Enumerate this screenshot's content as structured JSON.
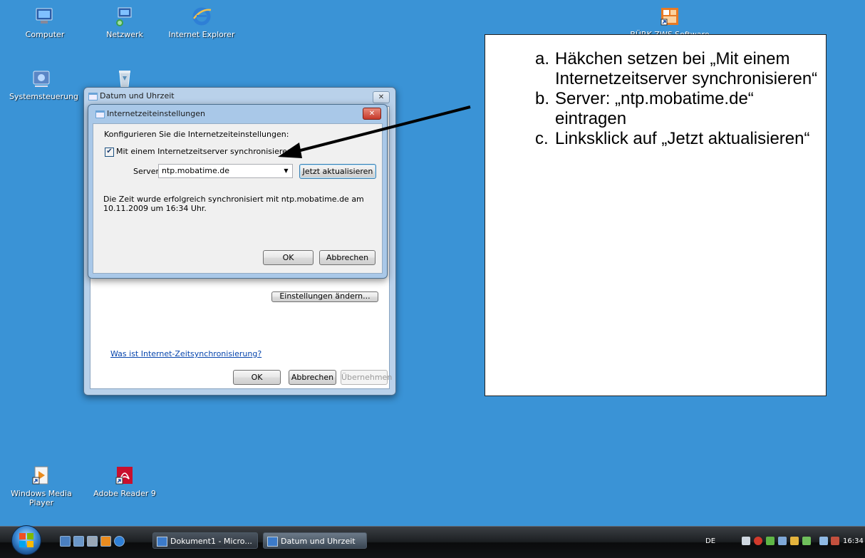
{
  "desktop": {
    "icons": [
      {
        "label": "Computer"
      },
      {
        "label": "Netzwerk"
      },
      {
        "label": "Internet Explorer"
      },
      {
        "label": "BÜRK ZWS Software"
      },
      {
        "label": "Systemsteuerung"
      },
      {
        "label": "Windows Media Player"
      },
      {
        "label": "Adobe Reader 9"
      }
    ]
  },
  "back_window": {
    "title": "Datum und Uhrzeit",
    "hidden_button_label": "Einstellungen ändern...",
    "help_link": "Was ist Internet-Zeitsynchronisierung?",
    "ok_label": "OK",
    "cancel_label": "Abbrechen",
    "apply_label": "Übernehmen"
  },
  "front_window": {
    "title": "Internetzeiteinstellungen",
    "intro": "Konfigurieren Sie die Internetzeiteinstellungen:",
    "sync_checkbox_label": "Mit einem Internetzeitserver synchronisieren",
    "sync_checked": true,
    "server_label": "Server:",
    "server_value": "ntp.mobatime.de",
    "update_button": "Jetzt aktualisieren",
    "status_line1": "Die Zeit wurde erfolgreich synchronisiert mit ntp.mobatime.de am",
    "status_line2": "10.11.2009 um 16:34 Uhr.",
    "ok_label": "OK",
    "cancel_label": "Abbrechen"
  },
  "instructions": {
    "items": [
      {
        "marker": "a.",
        "text": "Häkchen setzen bei „Mit einem Internetzeitserver synchronisieren“"
      },
      {
        "marker": "b.",
        "text": "Server: „ntp.mobatime.de“ eintragen"
      },
      {
        "marker": "c.",
        "text": "Linksklick auf „Jetzt aktualisieren“"
      }
    ]
  },
  "taskbar": {
    "buttons": [
      {
        "label": "Dokument1 - Micro..."
      },
      {
        "label": "Datum und Uhrzeit"
      }
    ],
    "language": "DE",
    "clock": "16:34"
  },
  "colors": {
    "desktop": "#3a93d6",
    "arrow": "#000000"
  }
}
